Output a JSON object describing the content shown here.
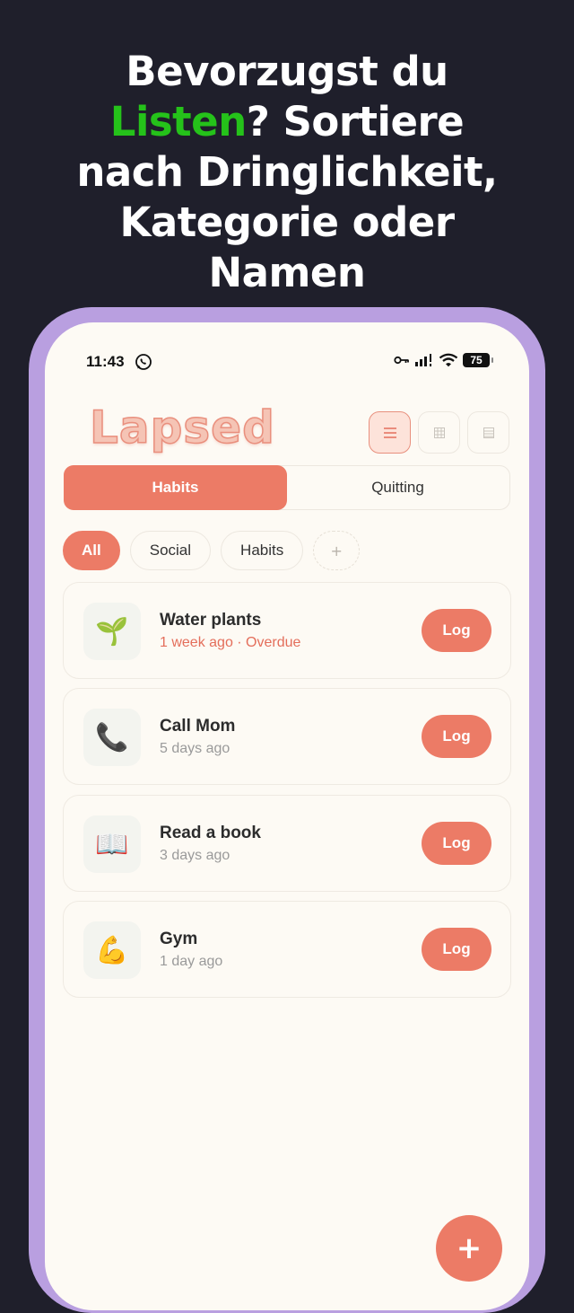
{
  "headline": {
    "line1": "Bevorzugst du",
    "highlight": "Listen",
    "line2_rest": "? Sortiere",
    "line3": "nach Dringlichkeit,",
    "line4": "Kategorie oder",
    "line5": "Namen"
  },
  "colors": {
    "background": "#1f1f2b",
    "highlight": "#25c21a",
    "phone_frame": "#b99fe0",
    "accent": "#ec7b66",
    "overdue": "#e46e5b"
  },
  "status_bar": {
    "time": "11:43",
    "battery": "75"
  },
  "app": {
    "logo": "Lapsed",
    "view_toggles": [
      {
        "icon": "list-view-icon",
        "active": true
      },
      {
        "icon": "grid-view-icon",
        "active": false
      },
      {
        "icon": "compact-view-icon",
        "active": false
      }
    ],
    "segments": [
      "Habits",
      "Quitting"
    ],
    "active_segment": "Habits",
    "chips": [
      "All",
      "Social",
      "Habits"
    ],
    "active_chip": "All",
    "add_chip": "+",
    "habits": [
      {
        "icon": "seedling-icon",
        "emoji": "🌱",
        "title": "Water plants",
        "subtitle": "1 week ago · Overdue",
        "overdue": true,
        "action": "Log"
      },
      {
        "icon": "phone-icon",
        "emoji": "📞",
        "title": "Call Mom",
        "subtitle": "5 days ago",
        "overdue": false,
        "action": "Log"
      },
      {
        "icon": "book-icon",
        "emoji": "📖",
        "title": "Read a book",
        "subtitle": "3 days ago",
        "overdue": false,
        "action": "Log"
      },
      {
        "icon": "flexed-biceps-icon",
        "emoji": "💪",
        "title": "Gym",
        "subtitle": "1 day ago",
        "overdue": false,
        "action": "Log"
      }
    ],
    "fab": "+"
  }
}
